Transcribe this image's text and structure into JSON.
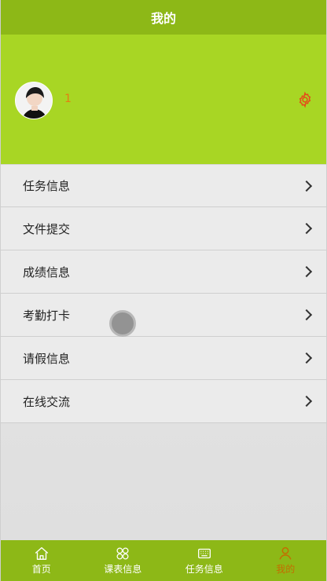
{
  "header": {
    "title": "我的"
  },
  "profile": {
    "username": "1"
  },
  "menu": {
    "items": [
      {
        "label": "任务信息"
      },
      {
        "label": "文件提交"
      },
      {
        "label": "成绩信息"
      },
      {
        "label": "考勤打卡"
      },
      {
        "label": "请假信息"
      },
      {
        "label": "在线交流"
      }
    ]
  },
  "tabbar": {
    "tabs": [
      {
        "label": "首页",
        "icon": "home-icon"
      },
      {
        "label": "课表信息",
        "icon": "grid-icon"
      },
      {
        "label": "任务信息",
        "icon": "keyboard-icon"
      },
      {
        "label": "我的",
        "icon": "user-icon",
        "active": true
      }
    ]
  },
  "colors": {
    "header_bg": "#8db817",
    "profile_bg": "#a8d624",
    "active_tab": "#c46d00",
    "username": "#e47e12",
    "settings_icon": "#e64a19"
  }
}
